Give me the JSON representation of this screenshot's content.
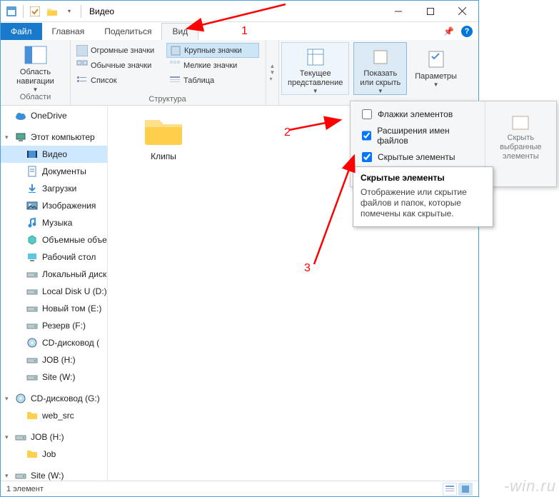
{
  "title": "Видео",
  "tabs": {
    "file": "Файл",
    "home": "Главная",
    "share": "Поделиться",
    "view": "Вид"
  },
  "ribbon": {
    "panes": {
      "nav": "Область\nнавигации",
      "nav_group": "Области"
    },
    "layout": {
      "group": "Структура",
      "items": [
        "Огромные значки",
        "Крупные значки",
        "Обычные значки",
        "Мелкие значки",
        "Список",
        "Таблица"
      ],
      "selected": "Крупные значки"
    },
    "current_view": "Текущее\nпредставление",
    "show_hide": "Показать\nили скрыть",
    "options": "Параметры"
  },
  "flyout": {
    "group": "Показать или скрыть",
    "checkboxes": [
      {
        "label": "Флажки элементов",
        "checked": false
      },
      {
        "label": "Расширения имен файлов",
        "checked": true
      },
      {
        "label": "Скрытые элементы",
        "checked": true
      }
    ],
    "hide_selected": "Скрыть выбранные\nэлементы"
  },
  "tooltip": {
    "title": "Скрытые элементы",
    "body": "Отображение или скрытие файлов и папок, которые помечены как скрытые."
  },
  "tree": [
    {
      "label": "OneDrive",
      "lvl": 1,
      "icon": "cloud"
    },
    {
      "label": "Этот компьютер",
      "lvl": 1,
      "icon": "pc",
      "caret": true
    },
    {
      "label": "Видео",
      "lvl": 2,
      "icon": "video",
      "selected": true
    },
    {
      "label": "Документы",
      "lvl": 2,
      "icon": "doc"
    },
    {
      "label": "Загрузки",
      "lvl": 2,
      "icon": "down"
    },
    {
      "label": "Изображения",
      "lvl": 2,
      "icon": "img"
    },
    {
      "label": "Музыка",
      "lvl": 2,
      "icon": "music"
    },
    {
      "label": "Объемные объекты",
      "lvl": 2,
      "icon": "3d"
    },
    {
      "label": "Рабочий стол",
      "lvl": 2,
      "icon": "desk"
    },
    {
      "label": "Локальный диск",
      "lvl": 2,
      "icon": "drive"
    },
    {
      "label": "Local Disk U (D:)",
      "lvl": 2,
      "icon": "drive"
    },
    {
      "label": "Новый том (E:)",
      "lvl": 2,
      "icon": "drive"
    },
    {
      "label": "Резерв (F:)",
      "lvl": 2,
      "icon": "drive"
    },
    {
      "label": "CD-дисковод (",
      "lvl": 2,
      "icon": "cd"
    },
    {
      "label": "JOB (H:)",
      "lvl": 2,
      "icon": "drive"
    },
    {
      "label": "Site (W:)",
      "lvl": 2,
      "icon": "drive"
    },
    {
      "label": "CD-дисковод (G:)",
      "lvl": 1,
      "icon": "cd",
      "caret": true
    },
    {
      "label": "web_src",
      "lvl": 2,
      "icon": "folder"
    },
    {
      "label": "JOB (H:)",
      "lvl": 1,
      "icon": "drive",
      "caret": true
    },
    {
      "label": "Job",
      "lvl": 2,
      "icon": "folder"
    },
    {
      "label": "Site (W:)",
      "lvl": 1,
      "icon": "drive",
      "caret": true
    }
  ],
  "content": {
    "folder": "Клипы"
  },
  "status": {
    "left": "1 элемент"
  },
  "annotations": {
    "n1": "1",
    "n2": "2",
    "n3": "3"
  },
  "watermark": "-win.ru"
}
